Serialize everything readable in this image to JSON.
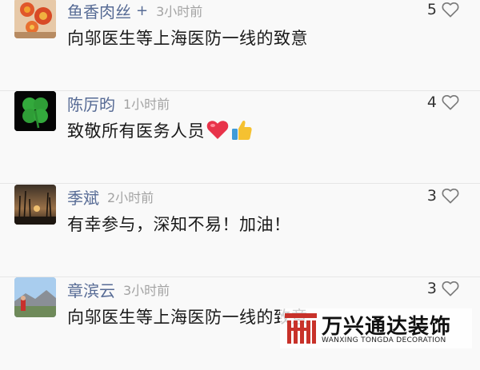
{
  "comments": [
    {
      "name": "鱼香肉丝",
      "follow_mark": "+",
      "time": "3小时前",
      "text": "向邬医生等上海医防一线的致意",
      "likes": "5",
      "avatar": "orange-flower-avatar"
    },
    {
      "name": "陈厉昀",
      "time": "1小时前",
      "text": "致敬所有医务人员",
      "likes": "4",
      "avatar": "clover-avatar"
    },
    {
      "name": "季斌",
      "time": "2小时前",
      "text": "有幸参与，深知不易！加油！",
      "likes": "3",
      "avatar": "sunset-avatar"
    },
    {
      "name": "章滨云",
      "time": "3小时前",
      "text": "向邬医生等上海医防一线的致意",
      "likes": "3",
      "avatar": "landscape-avatar"
    }
  ],
  "icons": {
    "like": "heart-outline-icon",
    "emoji_1": "red-heart-emoji",
    "emoji_2": "thumbs-up-emoji"
  },
  "colors": {
    "name": "#576b95",
    "time": "#a3a3a3",
    "text": "#1a1a1a",
    "divider": "#e6e6e6",
    "background": "#f9f9f9"
  },
  "watermark": {
    "title": "万兴通达装饰",
    "subtitle": "WANXING TONGDA DECORATION",
    "logo_color": "#c8322a"
  }
}
